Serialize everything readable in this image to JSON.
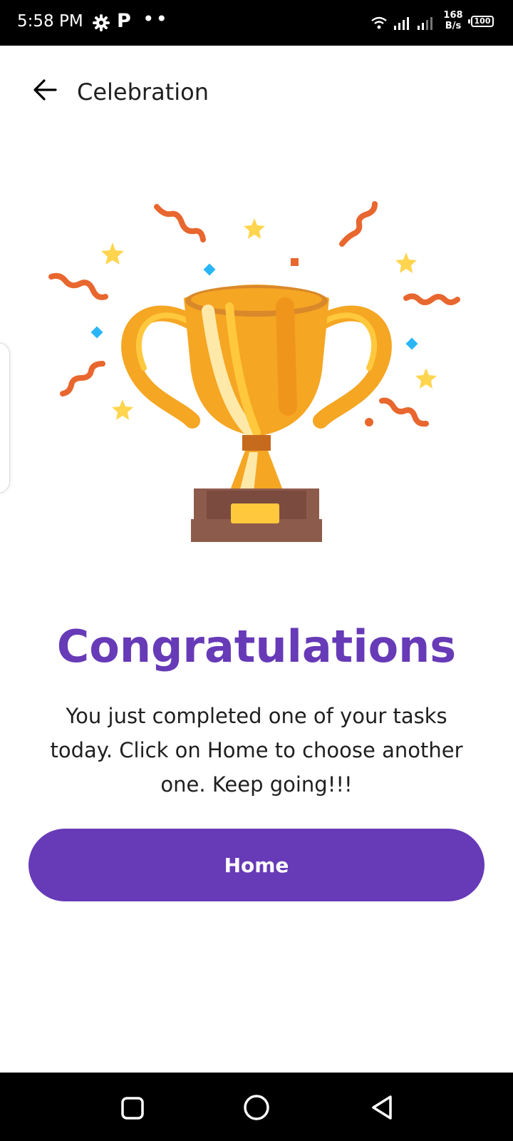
{
  "status_bar": {
    "time": "5:58 PM",
    "app_letter": "P",
    "dots": "••",
    "speed_value": "168",
    "speed_unit": "B/s",
    "battery": "100"
  },
  "app_bar": {
    "back_icon": "arrow-left-icon",
    "title": "Celebration"
  },
  "illustration": {
    "icon": "trophy-icon",
    "colors": {
      "gold": "#f5a623",
      "gold_light": "#ffc83d",
      "base": "#8d5b4c",
      "confetti_orange": "#e8672f",
      "confetti_blue": "#29b6f6",
      "star_yellow": "#ffd54f"
    }
  },
  "content": {
    "heading": "Congratulations",
    "message": "You just completed one of your tasks today. Click on Home to choose another one. Keep going!!!",
    "home_button_label": "Home"
  },
  "nav_bar": {
    "recent_icon": "square-icon",
    "home_icon": "circle-icon",
    "back_icon": "triangle-back-icon"
  },
  "theme": {
    "accent": "#673ab7",
    "text": "#1f1f1f",
    "background": "#ffffff"
  }
}
